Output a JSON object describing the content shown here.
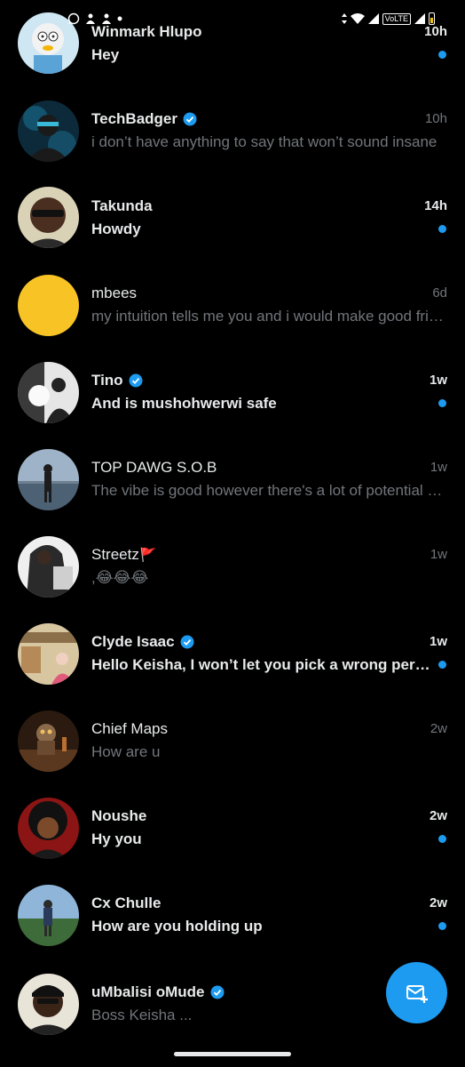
{
  "status_bar": {
    "icons_left": [
      "whatsapp-icon",
      "notification-icon",
      "notification-icon",
      "dot-icon"
    ],
    "icons_right": [
      "data-arrows-icon",
      "wifi-icon",
      "signal-icon",
      "volte-badge",
      "signal-icon",
      "battery-icon"
    ],
    "volte_label": "VoLTE"
  },
  "accent_color": "#1d9bf0",
  "conversations": [
    {
      "name": "Winmark Hlupo",
      "verified": false,
      "time": "10h",
      "preview": "Hey",
      "unread": true
    },
    {
      "name": "TechBadger",
      "verified": true,
      "time": "10h",
      "preview": "i don’t have anything to say that won’t sound insane",
      "unread": false
    },
    {
      "name": "Takunda",
      "verified": false,
      "time": "14h",
      "preview": "Howdy",
      "unread": true
    },
    {
      "name": "mbees",
      "verified": false,
      "time": "6d",
      "preview": "my intuition tells me you and i would make good friends",
      "unread": false
    },
    {
      "name": "Tino",
      "verified": true,
      "time": "1w",
      "preview": "And is mushohwerwi safe",
      "unread": true
    },
    {
      "name": "TOP DAWG S.O.B",
      "verified": false,
      "time": "1w",
      "preview": "The vibe is good  however there's a lot of potential here",
      "unread": false
    },
    {
      "name": "Streetz",
      "verified": false,
      "time": "1w",
      "preview": ",😂😂😂",
      "unread": false,
      "flag": "🚩"
    },
    {
      "name": "Clyde Isaac",
      "verified": true,
      "time": "1w",
      "preview": "Hello Keisha, I won’t let you pick a wrong person",
      "unread": true
    },
    {
      "name": "Chief Maps",
      "verified": false,
      "time": "2w",
      "preview": "How are u",
      "unread": false
    },
    {
      "name": "Noushe",
      "verified": false,
      "time": "2w",
      "preview": "Hy you",
      "unread": true
    },
    {
      "name": "Cx Chulle",
      "verified": false,
      "time": "2w",
      "preview": "How are you holding up",
      "unread": true
    },
    {
      "name": "uMbalisi oMude",
      "verified": true,
      "time": "",
      "preview": "Boss Keisha ...",
      "unread": false
    }
  ],
  "fab": {
    "icon": "new-message-icon"
  }
}
